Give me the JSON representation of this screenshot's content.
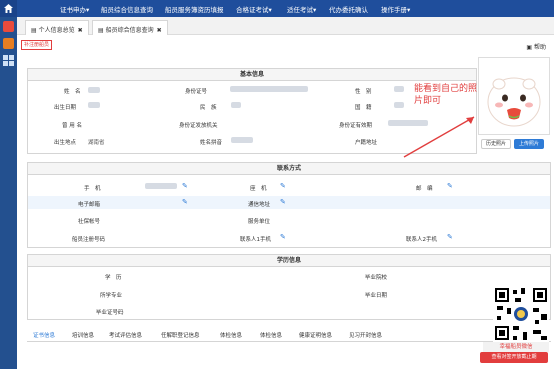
{
  "nav": {
    "items": [
      {
        "label": "证书申办▾"
      },
      {
        "label": "船员综合信息查询"
      },
      {
        "label": "船员服务簿资历填报"
      },
      {
        "label": "合格证考试▾"
      },
      {
        "label": "适任考试▾"
      },
      {
        "label": "代办委托确认"
      },
      {
        "label": "操作手册▾"
      }
    ]
  },
  "tabs": [
    {
      "label": "个人信息总览"
    },
    {
      "label": "船员综合信息查询"
    }
  ],
  "toolbar": {
    "badge": "补注册船员",
    "help": "帮助"
  },
  "basic": {
    "header": "基本信息",
    "name": "姓　名",
    "id_no": "身份证号",
    "gender": "性　别",
    "birth": "出生日期",
    "ethnic": "民　族",
    "nation": "国　籍",
    "former": "曾 用 名",
    "id_org": "身份证发放机关",
    "id_valid": "身份证有效期",
    "birthplace": "出生地点",
    "birthplace_value": "湖南省",
    "pinyin": "姓名拼音",
    "hukou": "户籍地址"
  },
  "photo": {
    "history_btn": "历史照片",
    "upload_btn": "上传照片"
  },
  "annotation": "能看到自己的照片即可",
  "contact": {
    "header": "联系方式",
    "mobile": "手　机",
    "phone": "座　机",
    "postcode": "邮　编",
    "email": "电子邮箱",
    "address": "通信地址",
    "social": "社保帐号",
    "unit": "服务单位",
    "reg_no": "船员注册号码",
    "c1": "联系人1手机",
    "c2": "联系人2手机"
  },
  "edu": {
    "header": "学历信息",
    "degree": "学　历",
    "school": "毕业院校",
    "major": "所学专业",
    "grad_date": "毕业日期",
    "cert_no": "毕业证号码"
  },
  "bottom_tabs": [
    "证书信息",
    "培训信息",
    "考试评估信息",
    "任解职登记信息",
    "体检信息",
    "体检信息",
    "健康证明信息",
    "见习开封信息"
  ],
  "qr": {
    "caption": "幸福船员微信"
  },
  "red_btn": "查看对签开放截止期"
}
